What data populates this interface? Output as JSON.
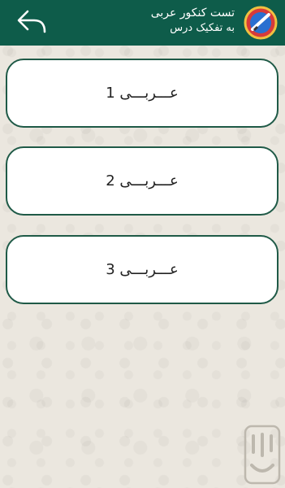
{
  "header": {
    "title": "تست کنکور عربی",
    "subtitle": "به تفکیک درس"
  },
  "lessons": [
    {
      "label": "عـــربـــی 1"
    },
    {
      "label": "عـــربـــی 2"
    },
    {
      "label": "عـــربـــی 3"
    }
  ],
  "icons": {
    "back": "back-arrow-icon",
    "logo": "app-logo-icon",
    "badge": "store-badge-icon"
  },
  "colors": {
    "header": "#0e5c4a",
    "card_border": "#1f5a47"
  }
}
